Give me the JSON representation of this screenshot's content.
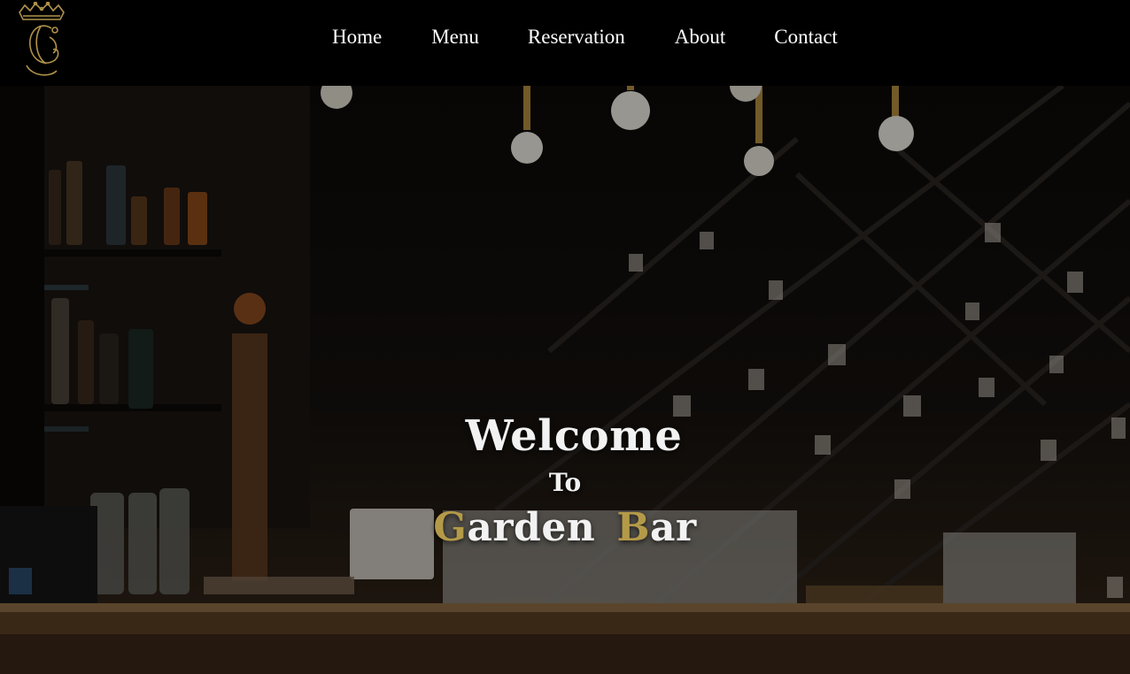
{
  "nav": {
    "links": [
      {
        "label": "Home"
      },
      {
        "label": "Menu"
      },
      {
        "label": "Reservation"
      },
      {
        "label": "About"
      },
      {
        "label": "Contact"
      }
    ]
  },
  "hero": {
    "welcome": "Welcome",
    "to": "To",
    "title_word1_initial": "G",
    "title_word1_rest": "arden",
    "title_word2_initial": "B",
    "title_word2_rest": "ar"
  },
  "colors": {
    "accent": "#b49a48",
    "nav_bg": "#000000",
    "text": "#ffffff"
  },
  "icons": {
    "logo": "crown-monogram-logo"
  }
}
